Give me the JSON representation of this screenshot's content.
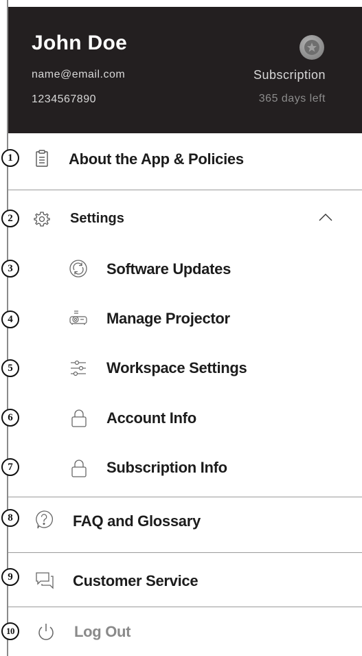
{
  "user": {
    "name": "John Doe",
    "email": "name@email.com",
    "phone": "1234567890"
  },
  "subscription": {
    "label": "Subscription",
    "days_left": "365 days left"
  },
  "menu": {
    "about": {
      "number": "1",
      "label": "About the App & Policies",
      "icon": "clipboard-icon"
    },
    "settings": {
      "number": "2",
      "label": "Settings",
      "icon": "gear-icon",
      "expanded": true
    },
    "software_updates": {
      "number": "3",
      "label": "Software Updates",
      "icon": "refresh-icon"
    },
    "manage_projector": {
      "number": "4",
      "label": "Manage Projector",
      "icon": "projector-icon"
    },
    "workspace_settings": {
      "number": "5",
      "label": "Workspace Settings",
      "icon": "sliders-icon"
    },
    "account_info": {
      "number": "6",
      "label": "Account Info",
      "icon": "lock-icon"
    },
    "subscription_info": {
      "number": "7",
      "label": "Subscription Info",
      "icon": "lock-icon"
    },
    "faq": {
      "number": "8",
      "label": "FAQ and Glossary",
      "icon": "question-icon"
    },
    "customer_service": {
      "number": "9",
      "label": "Customer Service",
      "icon": "chat-icon"
    },
    "logout": {
      "number": "10",
      "label": "Log Out",
      "icon": "power-icon"
    }
  },
  "colors": {
    "header_bg": "#231f20",
    "text": "#1c1c1c",
    "muted": "#8a8a8a",
    "divider": "#9a9a9a"
  }
}
